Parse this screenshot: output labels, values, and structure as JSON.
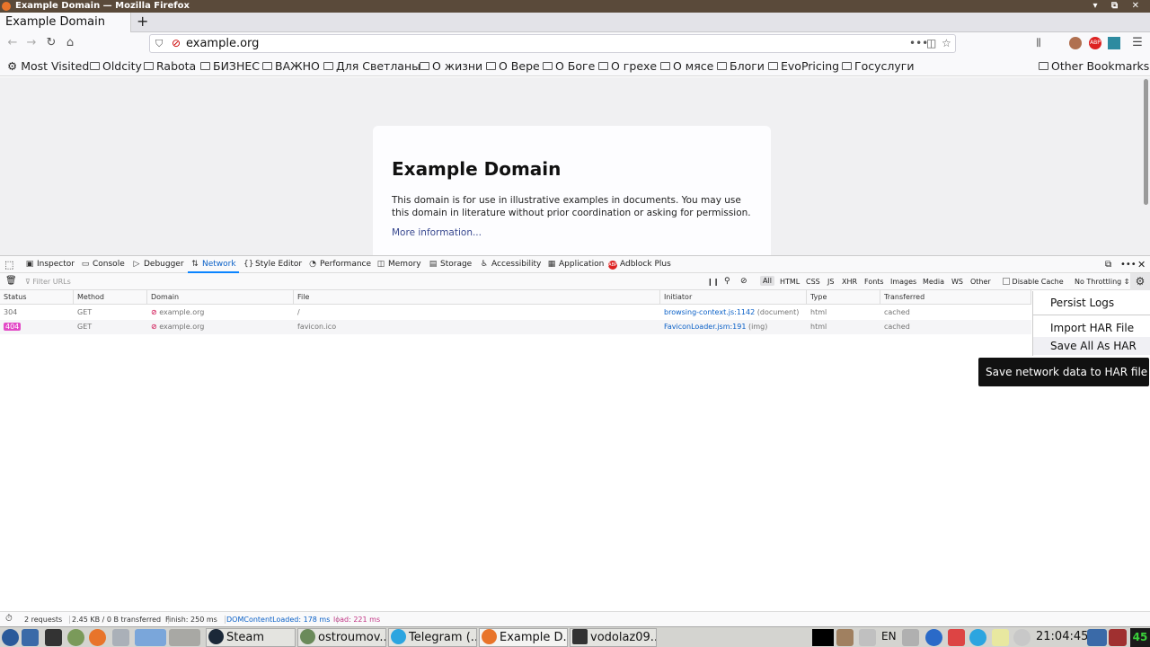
{
  "window": {
    "title": "Example Domain — Mozilla Firefox",
    "controls": "▾ ⧉ ✕"
  },
  "tabs": [
    {
      "label": "Example Domain"
    }
  ],
  "newtab_label": "+",
  "urlbar": {
    "url": "example.org",
    "more": "•••"
  },
  "bookmarks": {
    "items": [
      "Most Visited",
      "Oldcity",
      "Rabota",
      "БИЗНЕС",
      "ВАЖНО",
      "Для Светланы",
      "О жизни",
      "О Вере",
      "О Боге",
      "О грехе",
      "О мясе",
      "Блоги",
      "EvoPricing",
      "Госуслуги"
    ],
    "other": "Other Bookmarks"
  },
  "page": {
    "heading": "Example Domain",
    "paragraph": "This domain is for use in illustrative examples in documents. You may use this domain in literature without prior coordination or asking for permission.",
    "link": "More information..."
  },
  "devtools": {
    "tabs": [
      "Inspector",
      "Console",
      "Debugger",
      "Network",
      "Style Editor",
      "Performance",
      "Memory",
      "Storage",
      "Accessibility",
      "Application",
      "Adblock Plus"
    ],
    "active_tab": "Network",
    "filter_placeholder": "Filter URLs",
    "type_filters": [
      "All",
      "HTML",
      "CSS",
      "JS",
      "XHR",
      "Fonts",
      "Images",
      "Media",
      "WS",
      "Other"
    ],
    "disable_cache_label": "Disable Cache",
    "throttling": "No Throttling ⇕",
    "columns": [
      "Status",
      "Method",
      "Domain",
      "File",
      "Initiator",
      "Type",
      "Transferred"
    ],
    "requests": [
      {
        "status": "304",
        "method": "GET",
        "domain": "example.org",
        "file": "/",
        "initiator": "browsing-context.js:1142",
        "initiator_note": "(document)",
        "type": "html",
        "transferred": "cached"
      },
      {
        "status": "404",
        "method": "GET",
        "domain": "example.org",
        "file": "favicon.ico",
        "initiator": "FaviconLoader.jsm:191",
        "initiator_note": "(img)",
        "type": "html",
        "transferred": "cached"
      }
    ],
    "settings_menu": {
      "persist_logs": "Persist Logs",
      "import_har": "Import HAR File",
      "save_all_har": "Save All As HAR"
    },
    "tooltip": "Save network data to HAR file",
    "status": {
      "requests": "2 requests",
      "transferred": "2.45 KB / 0 B transferred",
      "finish": "Finish: 250 ms",
      "domcontentloaded": "DOMContentLoaded: 178 ms",
      "load": "load: 221 ms"
    }
  },
  "taskbar": {
    "tasks": [
      "Steam",
      "ostroumov...",
      "Telegram (...",
      "Example D...",
      "vodolaz09..."
    ],
    "lang": "EN",
    "clock": "21:04:45",
    "battery": "45"
  },
  "colors": {
    "accent": "#0a84ff",
    "status_404": "#e24ac6",
    "link": "#38488f"
  }
}
